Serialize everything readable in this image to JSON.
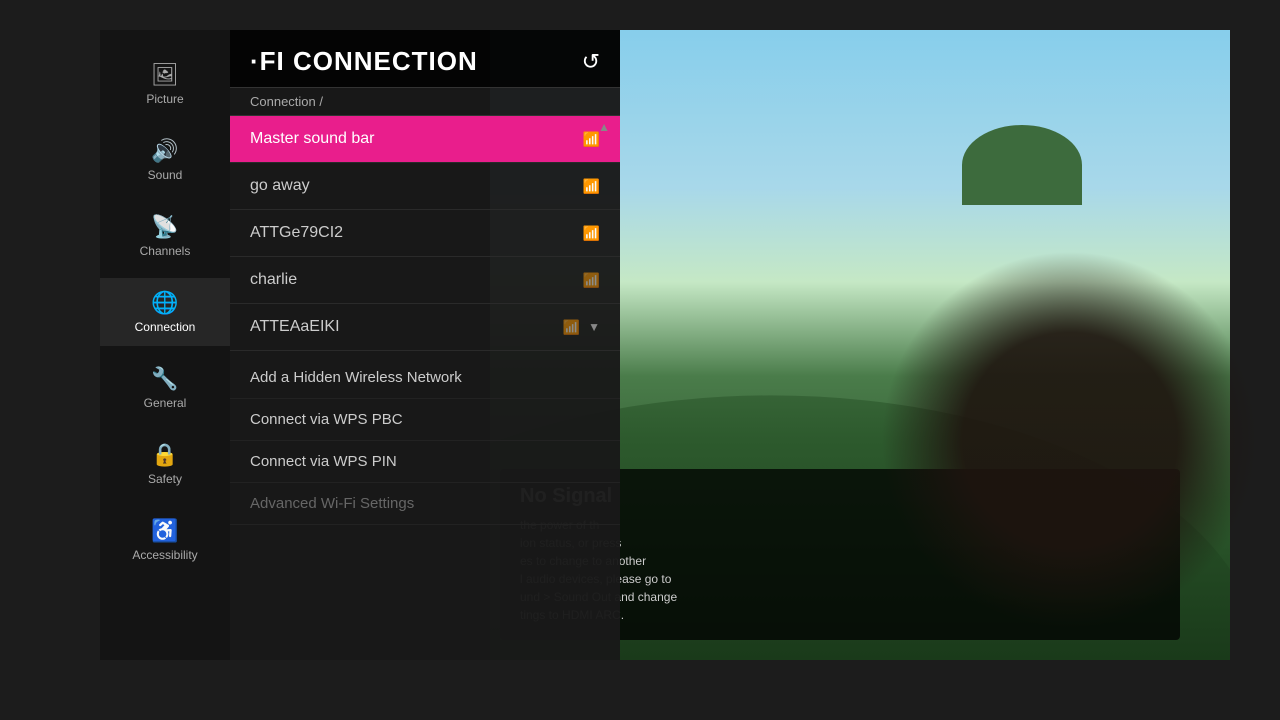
{
  "sidebar": {
    "items": [
      {
        "label": "Picture",
        "icon": "🖼",
        "active": false
      },
      {
        "label": "Sound",
        "icon": "🔊",
        "active": false
      },
      {
        "label": "Channels",
        "icon": "📡",
        "active": false
      },
      {
        "label": "Connection",
        "icon": "🌐",
        "active": true
      },
      {
        "label": "General",
        "icon": "🔧",
        "active": false
      },
      {
        "label": "Safety",
        "icon": "🔒",
        "active": false
      },
      {
        "label": "Accessibility",
        "icon": "♿",
        "active": false
      }
    ]
  },
  "panel": {
    "title": "·FI CONNECTION",
    "breadcrumb": "Connection /",
    "back_label": "↺"
  },
  "networks": [
    {
      "name": "Master sound bar",
      "signal": "strong",
      "selected": true
    },
    {
      "name": "go away",
      "signal": "strong",
      "selected": false
    },
    {
      "name": "ATTGe79CI2",
      "signal": "strong",
      "selected": false
    },
    {
      "name": "charlie",
      "signal": "weak",
      "selected": false
    },
    {
      "name": "ATTEAaEIKI",
      "signal": "weak",
      "selected": false
    }
  ],
  "bottom_options": [
    {
      "label": "Add a Hidden Wireless Network",
      "dimmed": false
    },
    {
      "label": "Connect via WPS PBC",
      "dimmed": false
    },
    {
      "label": "Connect via WPS PIN",
      "dimmed": false
    },
    {
      "label": "Advanced Wi-Fi Settings",
      "dimmed": true
    }
  ],
  "no_signal": {
    "title": "No Signal",
    "lines": [
      "the power of th",
      "ion status, or press",
      "es to change to another",
      "l audio devices, please go to",
      "und > Sound Out and change",
      "tings to HDMI ARC."
    ]
  },
  "icons": {
    "picture": "🖼",
    "sound": "🔊",
    "channels": "📡",
    "connection": "🌐",
    "general": "🔧",
    "safety": "🔒",
    "accessibility": "♿",
    "wifi_strong": "▲",
    "wifi_weak": "△",
    "back": "↺",
    "scroll_up": "▲",
    "scroll_down": "▼"
  },
  "colors": {
    "selected_bg": "#e91e8c",
    "sidebar_active": "#ffffff",
    "sidebar_inactive": "#aaaaaa"
  }
}
